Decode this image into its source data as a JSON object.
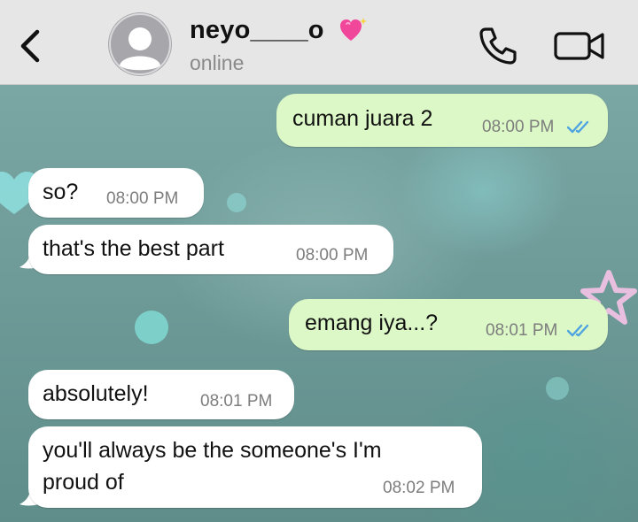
{
  "header": {
    "back_icon": "chevron-left-icon",
    "avatar_icon": "person-icon",
    "contact_name": "neyo____o",
    "name_emoji": "sparkling-heart-icon",
    "status": "online",
    "call_icon": "phone-icon",
    "video_icon": "video-camera-icon"
  },
  "messages": [
    {
      "direction": "out",
      "text": "cuman juara 2",
      "time": "08:00 PM",
      "read": true
    },
    {
      "direction": "in",
      "text": "so?",
      "time": "08:00 PM"
    },
    {
      "direction": "in",
      "text": "that's the best part",
      "time": "08:00 PM"
    },
    {
      "direction": "out",
      "text": "emang iya...?",
      "time": "08:01 PM",
      "read": true
    },
    {
      "direction": "in",
      "text": "absolutely!",
      "time": "08:01 PM"
    },
    {
      "direction": "in",
      "text_line1": "you'll always be the someone's I'm",
      "text_line2": "proud of",
      "time": "08:02 PM"
    }
  ],
  "colors": {
    "incoming_bubble": "#ffffff",
    "outgoing_bubble": "#dcf8c6",
    "read_ticks": "#4fa3e0",
    "header_bg": "#e6e6e6"
  }
}
